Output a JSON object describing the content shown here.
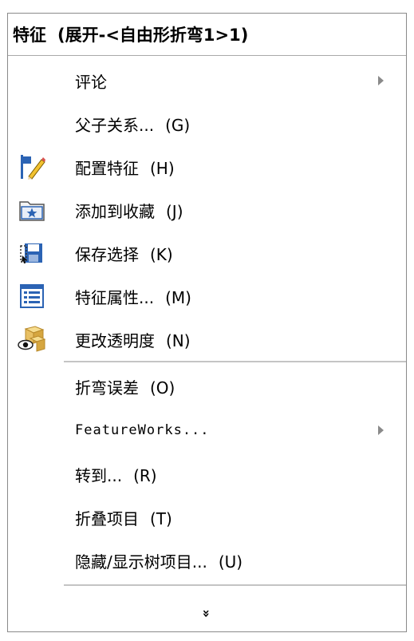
{
  "header": {
    "title": "特征",
    "context": "(展开-<自由形折弯1>1)"
  },
  "items": [
    {
      "label": "评论",
      "shortcut": "",
      "submenu": true,
      "icon": ""
    },
    {
      "label": "父子关系...",
      "shortcut": "(G)",
      "submenu": false,
      "icon": ""
    },
    {
      "label": "配置特征",
      "shortcut": "(H)",
      "submenu": false,
      "icon": "configure-feature-icon"
    },
    {
      "label": "添加到收藏",
      "shortcut": "(J)",
      "submenu": false,
      "icon": "add-to-favorites-icon"
    },
    {
      "label": "保存选择",
      "shortcut": "(K)",
      "submenu": false,
      "icon": "save-selection-icon"
    },
    {
      "label": "特征属性...",
      "shortcut": "(M)",
      "submenu": false,
      "icon": "feature-properties-icon"
    },
    {
      "label": "更改透明度",
      "shortcut": "(N)",
      "submenu": false,
      "icon": "change-transparency-icon"
    },
    {
      "label": "折弯误差",
      "shortcut": "(O)",
      "submenu": false,
      "icon": ""
    },
    {
      "label": "FeatureWorks...",
      "shortcut": "",
      "submenu": true,
      "icon": ""
    },
    {
      "label": "转到...",
      "shortcut": "(R)",
      "submenu": false,
      "icon": ""
    },
    {
      "label": "折叠项目",
      "shortcut": "(T)",
      "submenu": false,
      "icon": ""
    },
    {
      "label": "隐藏/显示树项目...",
      "shortcut": "(U)",
      "submenu": false,
      "icon": ""
    }
  ],
  "more_glyph": "»",
  "colors": {
    "border": "#8a8a8a",
    "separator": "#c4c4c4",
    "icon_blue": "#2b63b4",
    "icon_gold": "#e8c064"
  }
}
